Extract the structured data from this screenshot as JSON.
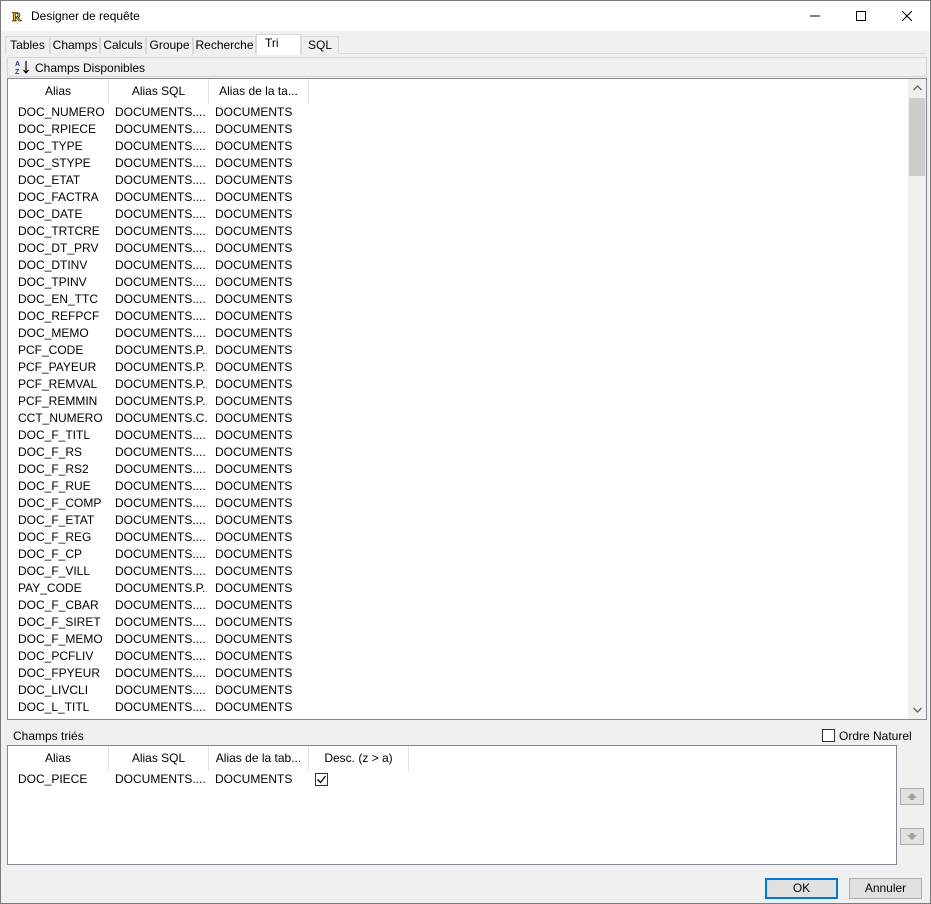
{
  "window": {
    "title": "Designer de requête"
  },
  "tabs": [
    "Tables",
    "Champs",
    "Calculs",
    "Groupe",
    "Recherche",
    "Tri",
    "SQL"
  ],
  "active_tab": "Tri",
  "available": {
    "header_label": "Champs Disponibles",
    "columns": [
      "Alias",
      "Alias SQL",
      "Alias de la ta..."
    ],
    "rows": [
      [
        "DOC_NUMERO",
        "DOCUMENTS....",
        "DOCUMENTS"
      ],
      [
        "DOC_RPIECE",
        "DOCUMENTS....",
        "DOCUMENTS"
      ],
      [
        "DOC_TYPE",
        "DOCUMENTS....",
        "DOCUMENTS"
      ],
      [
        "DOC_STYPE",
        "DOCUMENTS....",
        "DOCUMENTS"
      ],
      [
        "DOC_ETAT",
        "DOCUMENTS....",
        "DOCUMENTS"
      ],
      [
        "DOC_FACTRA",
        "DOCUMENTS....",
        "DOCUMENTS"
      ],
      [
        "DOC_DATE",
        "DOCUMENTS....",
        "DOCUMENTS"
      ],
      [
        "DOC_TRTCRE",
        "DOCUMENTS....",
        "DOCUMENTS"
      ],
      [
        "DOC_DT_PRV",
        "DOCUMENTS....",
        "DOCUMENTS"
      ],
      [
        "DOC_DTINV",
        "DOCUMENTS....",
        "DOCUMENTS"
      ],
      [
        "DOC_TPINV",
        "DOCUMENTS....",
        "DOCUMENTS"
      ],
      [
        "DOC_EN_TTC",
        "DOCUMENTS....",
        "DOCUMENTS"
      ],
      [
        "DOC_REFPCF",
        "DOCUMENTS....",
        "DOCUMENTS"
      ],
      [
        "DOC_MEMO",
        "DOCUMENTS....",
        "DOCUMENTS"
      ],
      [
        "PCF_CODE",
        "DOCUMENTS.P...",
        "DOCUMENTS"
      ],
      [
        "PCF_PAYEUR",
        "DOCUMENTS.P...",
        "DOCUMENTS"
      ],
      [
        "PCF_REMVAL",
        "DOCUMENTS.P...",
        "DOCUMENTS"
      ],
      [
        "PCF_REMMIN",
        "DOCUMENTS.P...",
        "DOCUMENTS"
      ],
      [
        "CCT_NUMERO",
        "DOCUMENTS.C...",
        "DOCUMENTS"
      ],
      [
        "DOC_F_TITL",
        "DOCUMENTS....",
        "DOCUMENTS"
      ],
      [
        "DOC_F_RS",
        "DOCUMENTS....",
        "DOCUMENTS"
      ],
      [
        "DOC_F_RS2",
        "DOCUMENTS....",
        "DOCUMENTS"
      ],
      [
        "DOC_F_RUE",
        "DOCUMENTS....",
        "DOCUMENTS"
      ],
      [
        "DOC_F_COMP",
        "DOCUMENTS....",
        "DOCUMENTS"
      ],
      [
        "DOC_F_ETAT",
        "DOCUMENTS....",
        "DOCUMENTS"
      ],
      [
        "DOC_F_REG",
        "DOCUMENTS....",
        "DOCUMENTS"
      ],
      [
        "DOC_F_CP",
        "DOCUMENTS....",
        "DOCUMENTS"
      ],
      [
        "DOC_F_VILL",
        "DOCUMENTS....",
        "DOCUMENTS"
      ],
      [
        "PAY_CODE",
        "DOCUMENTS.P...",
        "DOCUMENTS"
      ],
      [
        "DOC_F_CBAR",
        "DOCUMENTS....",
        "DOCUMENTS"
      ],
      [
        "DOC_F_SIRET",
        "DOCUMENTS....",
        "DOCUMENTS"
      ],
      [
        "DOC_F_MEMO",
        "DOCUMENTS....",
        "DOCUMENTS"
      ],
      [
        "DOC_PCFLIV",
        "DOCUMENTS....",
        "DOCUMENTS"
      ],
      [
        "DOC_FPYEUR",
        "DOCUMENTS....",
        "DOCUMENTS"
      ],
      [
        "DOC_LIVCLI",
        "DOCUMENTS....",
        "DOCUMENTS"
      ],
      [
        "DOC_L_TITL",
        "DOCUMENTS....",
        "DOCUMENTS"
      ]
    ]
  },
  "sorted": {
    "label": "Champs triés",
    "natural_order_label": "Ordre Naturel",
    "natural_order_checked": false,
    "columns": [
      "Alias",
      "Alias SQL",
      "Alias de la tab...",
      "Desc. (z > a)"
    ],
    "rows": [
      {
        "alias": "DOC_PIECE",
        "alias_sql": "DOCUMENTS....",
        "table_alias": "DOCUMENTS",
        "desc": true
      }
    ]
  },
  "buttons": {
    "ok": "OK",
    "cancel": "Annuler"
  },
  "icons": {
    "app": "app-logo-icon",
    "sort": "sort-az-icon",
    "move_up": "arrow-up-icon",
    "move_down": "arrow-down-icon"
  },
  "colors": {
    "ok_border": "#0078d7",
    "window_bg": "#f0f0f0"
  }
}
